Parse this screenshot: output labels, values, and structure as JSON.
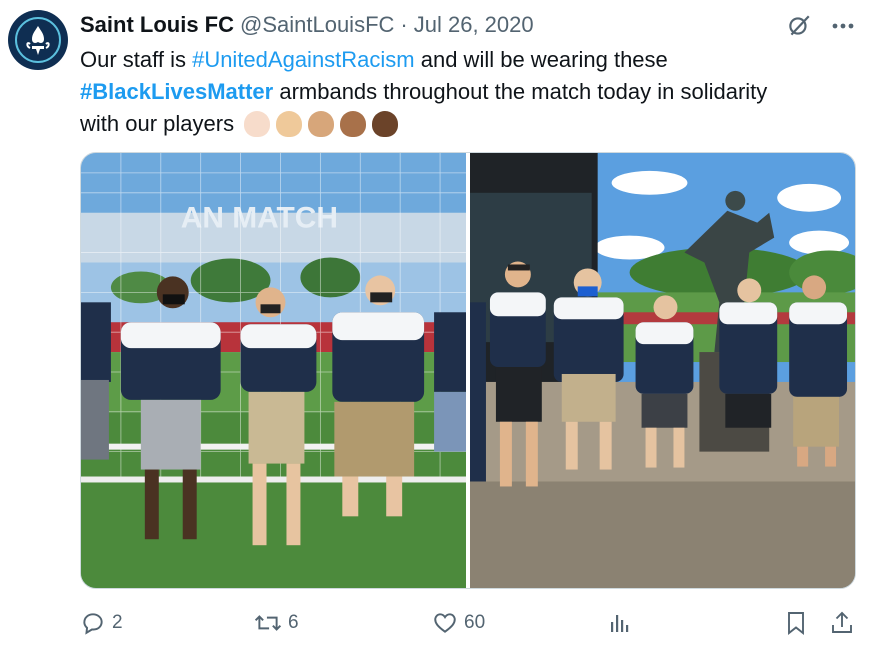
{
  "tweet": {
    "display_name": "Saint Louis FC",
    "handle": "@SaintLouisFC",
    "separator": "·",
    "date": "Jul 26, 2020",
    "text_line1_prefix": "Our staff is ",
    "hashtag1": "#UnitedAgainstRacism",
    "text_line1_suffix": " and will be wearing these",
    "hashtag2": "#BlackLivesMatter",
    "text_line2_suffix": " armbands throughout the match today in solidarity",
    "text_line3": "with our players",
    "fist_skin_tones": [
      "#f7dccb",
      "#efc99a",
      "#d7a67a",
      "#a8714a",
      "#6b4329"
    ]
  },
  "avatar": {
    "logo_text_top": "SAINT LOUIS",
    "logo_text_bottom": "FOOTBALL CLUB",
    "colors": {
      "background": "#0f2e52",
      "accent": "#5bc0de"
    }
  },
  "header_icons": [
    "grok-icon",
    "more-icon"
  ],
  "media": {
    "photos": [
      {
        "scene": "staff on soccer field in front of goal net"
      },
      {
        "scene": "staff in front of stadium with player statue"
      }
    ],
    "stadium_banner_text": "AN MATCH"
  },
  "actions": {
    "reply_count": "2",
    "retweet_count": "6",
    "like_count": "60",
    "icons": [
      "reply-icon",
      "retweet-icon",
      "like-icon",
      "views-icon",
      "bookmark-icon",
      "share-icon"
    ]
  },
  "colors": {
    "link": "#1d9bf0",
    "secondary_text": "#536471",
    "primary_text": "#0f1419"
  }
}
